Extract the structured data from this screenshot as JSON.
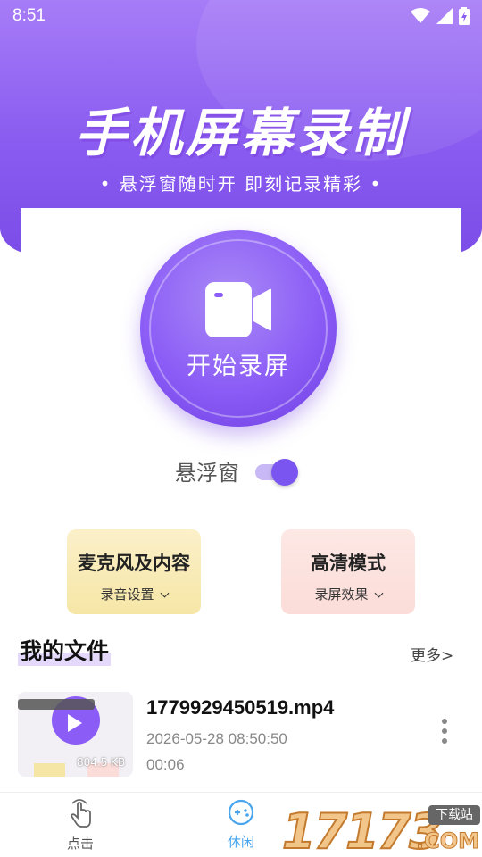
{
  "status_bar": {
    "time": "8:51"
  },
  "hero": {
    "title": "手机屏幕录制",
    "subtitle": "• 悬浮窗随时开  即刻记录精彩 •"
  },
  "record": {
    "label": "开始录屏",
    "icon": "video-camera-icon"
  },
  "float_window": {
    "label": "悬浮窗",
    "enabled": true
  },
  "options": [
    {
      "title": "麦克风及内容",
      "subtitle": "录音设置",
      "color": "#f6e6a6"
    },
    {
      "title": "高清模式",
      "subtitle": "录屏效果",
      "color": "#fbdcd8"
    }
  ],
  "files": {
    "title": "我的文件",
    "more": "更多>",
    "items": [
      {
        "name": "1779929450519.mp4",
        "date": "2026-05-28 08:50:50",
        "duration": "00:06",
        "thumb_size": "804.5 KB"
      }
    ]
  },
  "nav": {
    "items": [
      {
        "label": "点击",
        "icon": "tap-hand-icon",
        "active": false
      },
      {
        "label": "休闲",
        "icon": "gamepad-icon",
        "active": true
      }
    ]
  },
  "watermark": {
    "number": "17173",
    "tag": "下载站",
    "suffix": ".COM"
  },
  "colors": {
    "primary": "#8b5cf6",
    "nav_active": "#49a6ee"
  }
}
